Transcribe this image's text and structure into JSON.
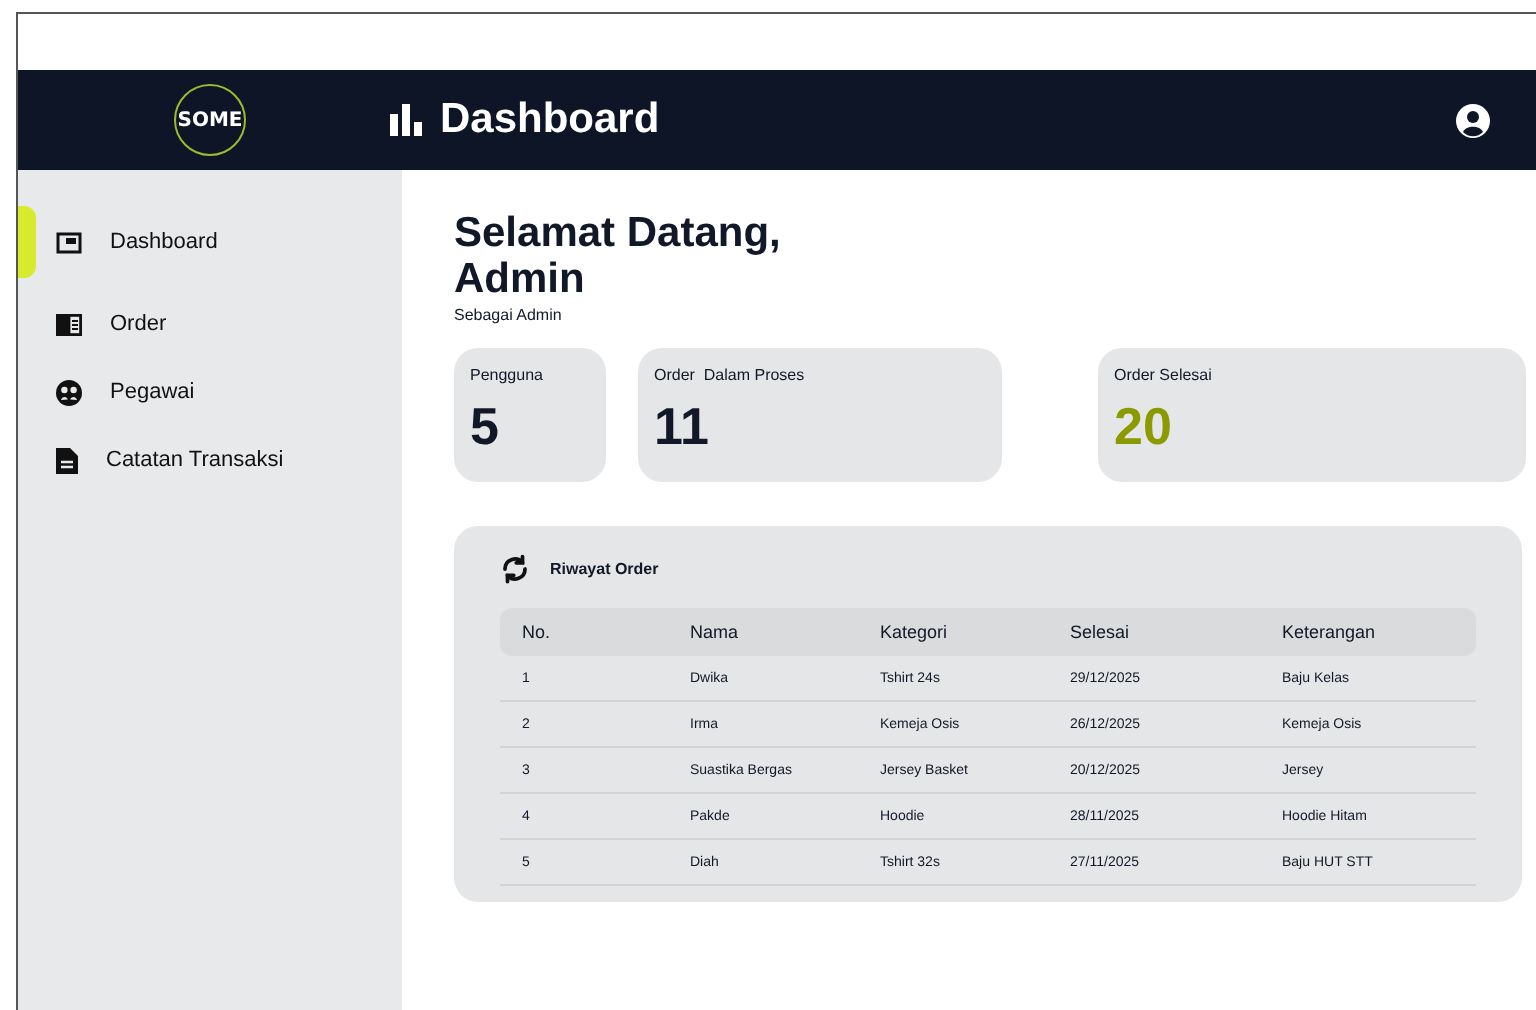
{
  "header": {
    "logo": "SOME",
    "title": "Dashboard"
  },
  "sidebar": {
    "items": [
      {
        "label": "Dashboard",
        "selected": true
      },
      {
        "label": "Order",
        "selected": false
      },
      {
        "label": "Pegawai",
        "selected": false
      },
      {
        "label": "Catatan Transaksi",
        "selected": false
      }
    ]
  },
  "welcome": {
    "greeting": "Selamat Datang,",
    "name": "Admin",
    "role": "Sebagai Admin"
  },
  "stats": [
    {
      "label": "Pengguna",
      "value": "5",
      "highlight": false
    },
    {
      "label": "Order  Dalam Proses",
      "value": "11",
      "highlight": false
    },
    {
      "label": "Order Selesai",
      "value": "20",
      "highlight": true
    }
  ],
  "table": {
    "title": "Riwayat Order",
    "columns": [
      "No.",
      "Nama",
      "Kategori",
      "Selesai",
      "Keterangan"
    ],
    "rows": [
      [
        "1",
        "Dwika",
        "Tshirt 24s",
        "29/12/2025",
        "Baju Kelas"
      ],
      [
        "2",
        "Irma",
        "Kemeja Osis",
        "26/12/2025",
        "Kemeja Osis"
      ],
      [
        "3",
        "Suastika Bergas",
        "Jersey Basket",
        "20/12/2025",
        "Jersey"
      ],
      [
        "4",
        "Pakde",
        "Hoodie",
        "28/11/2025",
        "Hoodie Hitam"
      ],
      [
        "5",
        "Diah",
        "Tshirt 32s",
        "27/11/2025",
        "Baju HUT STT"
      ]
    ]
  }
}
